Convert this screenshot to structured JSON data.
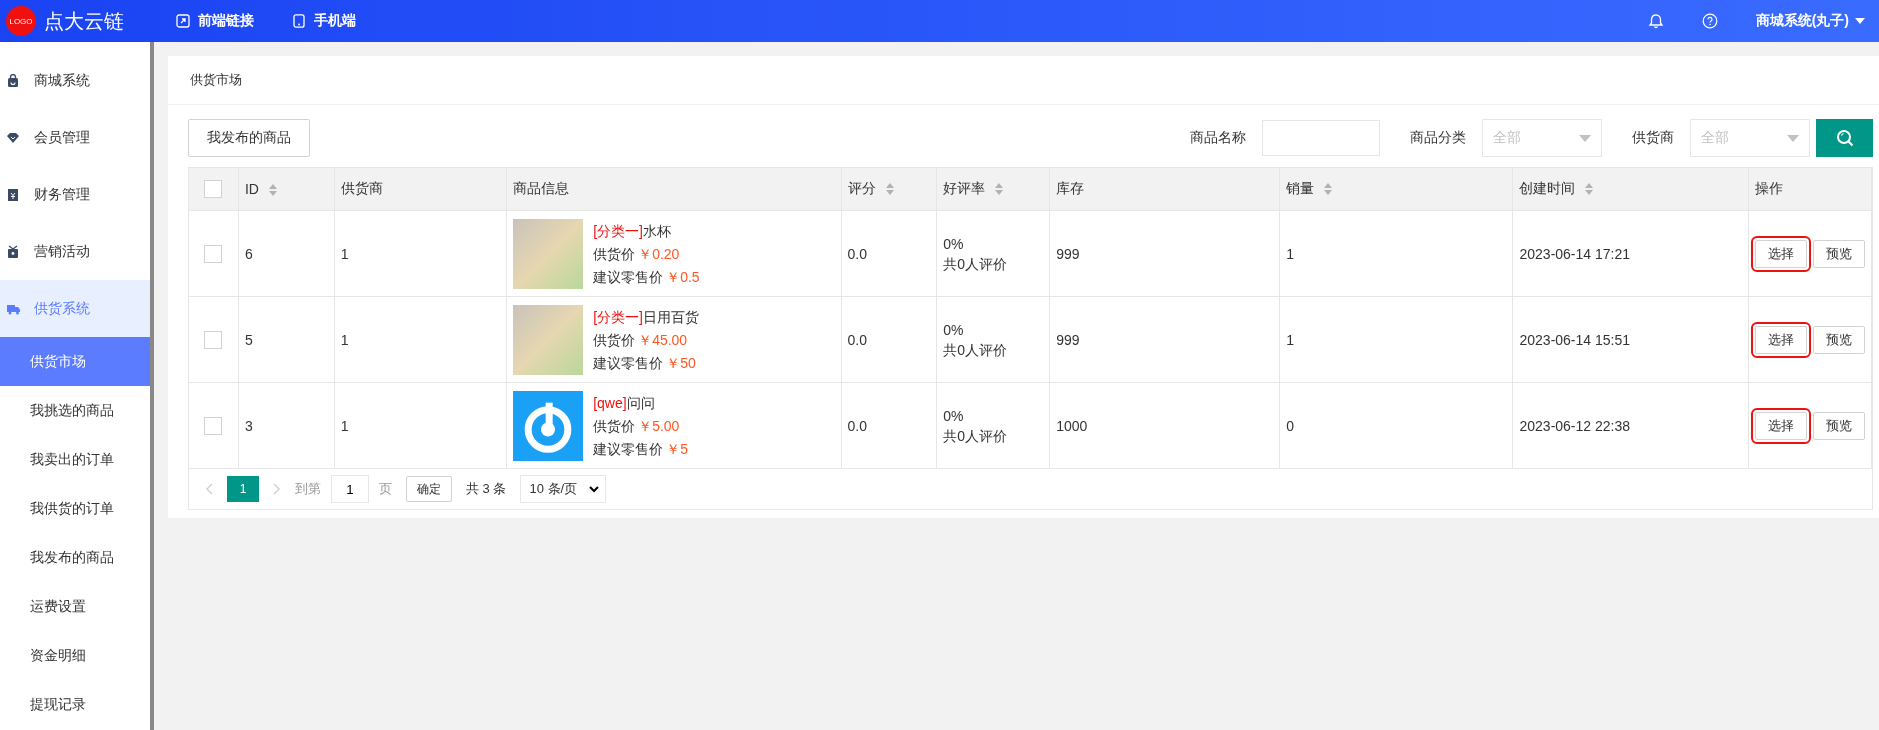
{
  "topbar": {
    "logo_badge": "LOGO",
    "brand": "点大云链",
    "links": [
      {
        "kind": "link",
        "label": "前端链接"
      },
      {
        "kind": "phone",
        "label": "手机端"
      }
    ],
    "user": "商城系统(丸子)"
  },
  "sidebar": {
    "items": [
      {
        "kind": "bag",
        "label": "商城系统",
        "selected": false
      },
      {
        "kind": "gem",
        "label": "会员管理",
        "selected": false
      },
      {
        "kind": "yen",
        "label": "财务管理",
        "selected": false
      },
      {
        "kind": "gift",
        "label": "营销活动",
        "selected": false
      },
      {
        "kind": "truck",
        "label": "供货系统",
        "selected": true,
        "children": [
          {
            "label": "供货市场",
            "selected": true
          },
          {
            "label": "我挑选的商品",
            "selected": false
          },
          {
            "label": "我卖出的订单",
            "selected": false
          },
          {
            "label": "我供货的订单",
            "selected": false
          },
          {
            "label": "我发布的商品",
            "selected": false
          },
          {
            "label": "运费设置",
            "selected": false
          },
          {
            "label": "资金明细",
            "selected": false
          },
          {
            "label": "提现记录",
            "selected": false
          }
        ]
      }
    ]
  },
  "card": {
    "title": "供货市场",
    "my_products_button": "我发布的商品",
    "filters": [
      {
        "kind": "input",
        "label": "商品名称"
      },
      {
        "kind": "select",
        "label": "商品分类",
        "placeholder": "全部"
      },
      {
        "kind": "select",
        "label": "供货商",
        "placeholder": "全部"
      }
    ]
  },
  "table": {
    "all_checked": false,
    "columns": [
      {
        "label": "ID",
        "sortable": true
      },
      {
        "label": "供货商",
        "sortable": false
      },
      {
        "label": "商品信息",
        "sortable": false
      },
      {
        "label": "评分",
        "sortable": true
      },
      {
        "label": "好评率",
        "sortable": true
      },
      {
        "label": "库存",
        "sortable": false
      },
      {
        "label": "销量",
        "sortable": true
      },
      {
        "label": "创建时间",
        "sortable": true
      },
      {
        "label": "操作",
        "sortable": false
      }
    ],
    "rows": [
      {
        "checked": false,
        "id": "6",
        "supplier": "1",
        "kind": "photo",
        "category": "[分类一]",
        "name": "水杯",
        "supply_label": "供货价",
        "supply_price": "￥0.20",
        "retail_label": "建议零售价",
        "retail_price": "￥0.5",
        "score": "0.0",
        "rate": "0%",
        "reviews": "共0人评价",
        "stock": "999",
        "sales": "1",
        "created": "2023-06-14 17:21",
        "select": "选择",
        "preview": "预览",
        "highlighted": true
      },
      {
        "checked": false,
        "id": "5",
        "supplier": "1",
        "kind": "photo",
        "category": "[分类一]",
        "name": "日用百货",
        "supply_label": "供货价",
        "supply_price": "￥45.00",
        "retail_label": "建议零售价",
        "retail_price": "￥50",
        "score": "0.0",
        "rate": "0%",
        "reviews": "共0人评价",
        "stock": "999",
        "sales": "1",
        "created": "2023-06-14 15:51",
        "select": "选择",
        "preview": "预览",
        "highlighted": true
      },
      {
        "checked": false,
        "id": "3",
        "supplier": "1",
        "kind": "logo",
        "category": "[qwe]",
        "name": "问问",
        "supply_label": "供货价",
        "supply_price": "￥5.00",
        "retail_label": "建议零售价",
        "retail_price": "￥5",
        "score": "0.0",
        "rate": "0%",
        "reviews": "共0人评价",
        "stock": "1000",
        "sales": "0",
        "created": "2023-06-12 22:38",
        "select": "选择",
        "preview": "预览",
        "highlighted": true
      }
    ]
  },
  "pagination": {
    "pages": [
      {
        "label": "1",
        "selected": true
      }
    ],
    "goto_label": "到第",
    "goto_value": "1",
    "page_unit": "页",
    "confirm": "确定",
    "total": "共 3 条",
    "page_size": "10 条/页"
  }
}
